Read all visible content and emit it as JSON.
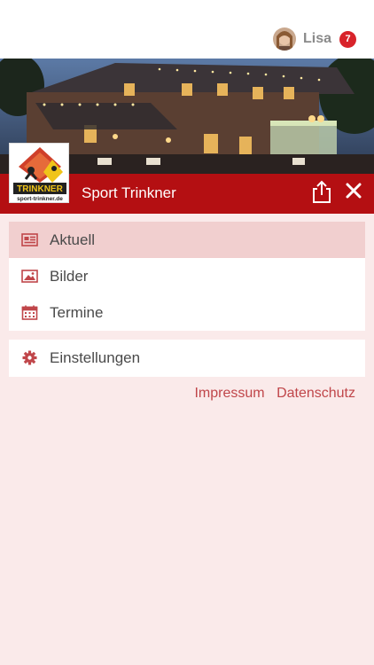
{
  "user": {
    "name": "Lisa",
    "notification_count": "7"
  },
  "header": {
    "shop_name": "Sport Trinkner"
  },
  "logo": {
    "text_main": "TRINKNER",
    "text_url": "sport-trinkner.de"
  },
  "menu": {
    "main_items": [
      {
        "label": "Aktuell",
        "icon": "newspaper-icon",
        "active": true
      },
      {
        "label": "Bilder",
        "icon": "image-icon",
        "active": false
      },
      {
        "label": "Termine",
        "icon": "calendar-icon",
        "active": false
      }
    ],
    "settings_item": {
      "label": "Einstellungen",
      "icon": "gear-icon"
    }
  },
  "footer": {
    "impressum": "Impressum",
    "datenschutz": "Datenschutz"
  },
  "colors": {
    "brand_red": "#b40f12",
    "icon_red": "#c0464a",
    "badge_red": "#d8232a",
    "background": "#faeaea",
    "active_row": "#f1cfcf"
  }
}
